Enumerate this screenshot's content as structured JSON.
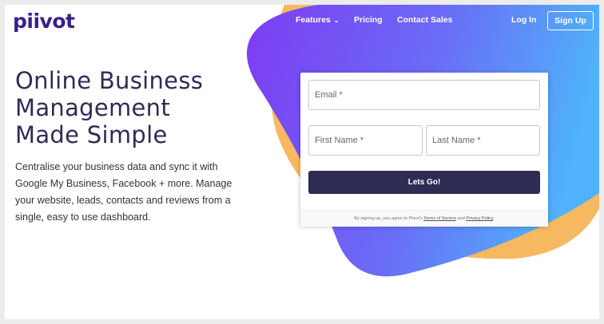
{
  "brand": {
    "logo_text": "piivot"
  },
  "nav": {
    "features": "Features",
    "features_chevron": "chevron-down-icon",
    "pricing": "Pricing",
    "contact_sales": "Contact Sales",
    "login": "Log In",
    "signup": "Sign Up"
  },
  "hero": {
    "headline_line1": "Online Business",
    "headline_line2": "Management",
    "headline_line3": "Made Simple",
    "description": "Centralise your business data and sync it with Google My Business, Facebook + more. Manage your website, leads, contacts and reviews from a single, easy to use dashboard."
  },
  "form": {
    "email_placeholder": "Email *",
    "first_name_placeholder": "First Name *",
    "last_name_placeholder": "Last Name *",
    "submit_label": "Lets Go!",
    "terms_prefix": "By signing up, you agree to Piivot's ",
    "terms_link": "Terms of Service",
    "terms_and": " and ",
    "privacy_link": "Privacy Policy",
    "terms_suffix": "."
  },
  "colors": {
    "brand_purple": "#3d1d8c",
    "navy": "#2e2c55",
    "gradient_start": "#7d3cf2",
    "gradient_end": "#4fb2fb",
    "orange": "#f6b860"
  }
}
